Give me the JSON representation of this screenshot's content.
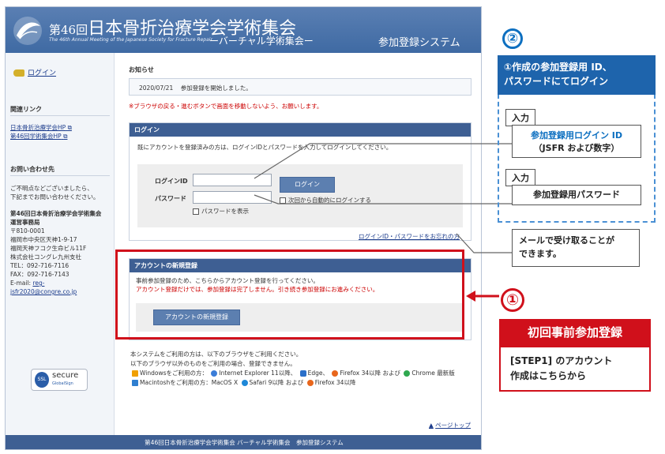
{
  "header": {
    "title_prefix": "第46回",
    "title_main": "日本骨折治療学会学術集会",
    "subtitle_en": "The 46th Annual Meeting of the Japanese Society for Fracture Repair",
    "virtual": "ーバーチャル学術集会ー",
    "system": "参加登録システム"
  },
  "sidebar": {
    "login": "ログイン",
    "links_heading": "関連リンク",
    "links": [
      "日本骨折治療学会HP",
      "第46回学術集会HP"
    ],
    "contact_heading": "お問い合わせ先",
    "contact_lines": [
      "ご不明点などございましたら、",
      "下記までお問い合わせください。"
    ],
    "office_lines": [
      "第46回日本骨折治療学会学術集会",
      "運営事務局"
    ],
    "address_lines": [
      "〒810-0001",
      "福岡市中央区天神1-9-17",
      "福岡天神フコク生命ビル11F",
      "株式会社コングレ九州支社",
      "TEL：092-716-7116",
      "FAX：092-716-7143"
    ],
    "email_label": "E-mail: ",
    "email_1": "reg-",
    "email_2": "jsfr2020@congre.co.jp",
    "ssl_main": "secure",
    "ssl_sub": "GlobalSign"
  },
  "main": {
    "notice_heading": "お知らせ",
    "notice_date": "2020/07/21",
    "notice_text": "参加登録を開始しました。",
    "warning": "※ブラウザの戻る・進むボタンで画面を移動しないよう、お願いします。",
    "login_heading": "ログイン",
    "login_desc": "既にアカウントを登録済みの方は、ログインIDとパスワードを入力してログインしてください。",
    "login_id_label": "ログインID",
    "password_label": "パスワード",
    "login_button": "ログイン",
    "auto_login": "次回から自動的にログインする",
    "show_password": "パスワードを表示",
    "forgot": "ログインID・パスワードをお忘れの方",
    "new_heading": "アカウントの新規登録",
    "new_desc1": "事前参加登録のため、こちらからアカウント登録を行ってください。",
    "new_desc2": "アカウント登録だけでは、参加登録は完了しません。引き続き参加登録にお進みください。",
    "new_button": "アカウントの新規登録",
    "browser_1": "本システムをご利用の方は、以下のブラウザをご利用ください。",
    "browser_2": "以下のブラウザ以外のものをご利用の場合、登録できません。",
    "windows_label": "Windowsをご利用の方：",
    "ie": "Internet Explorer 11以降、",
    "edge": "Edge、",
    "firefox_win": "Firefox 34以降 および",
    "chrome": "Chrome 最新版",
    "mac_label": "Macintoshをご利用の方：MacOS X",
    "safari": "Safari 9以降 および",
    "firefox_mac": "Firefox 34以降",
    "pagetop": "ページトップ",
    "footer": "第46回日本骨折治療学会学術集会 バーチャル学術集会　参加登録システム"
  },
  "annotations": {
    "step2_number": "②",
    "step2_heading_1": "①作成の参加登録用 ID、",
    "step2_heading_2": "パスワードにてログイン",
    "input_tag_1": "入力",
    "id_card_1": "参加登録用ログイン ID",
    "id_card_2": "（JSFR および数字）",
    "input_tag_2": "入力",
    "password_card": "参加登録用パスワード",
    "mail_1": "メールで受け取ることが",
    "mail_2": "できます。",
    "step1_number": "①",
    "step1_heading": "初回事前参加登録",
    "step1_body_1": "[STEP1] のアカウント",
    "step1_body_2": "作成はこちらから"
  },
  "colors": {
    "brand_blue": "#3e5f93",
    "accent_red": "#d0101b",
    "annotation_blue": "#1e64ac"
  }
}
